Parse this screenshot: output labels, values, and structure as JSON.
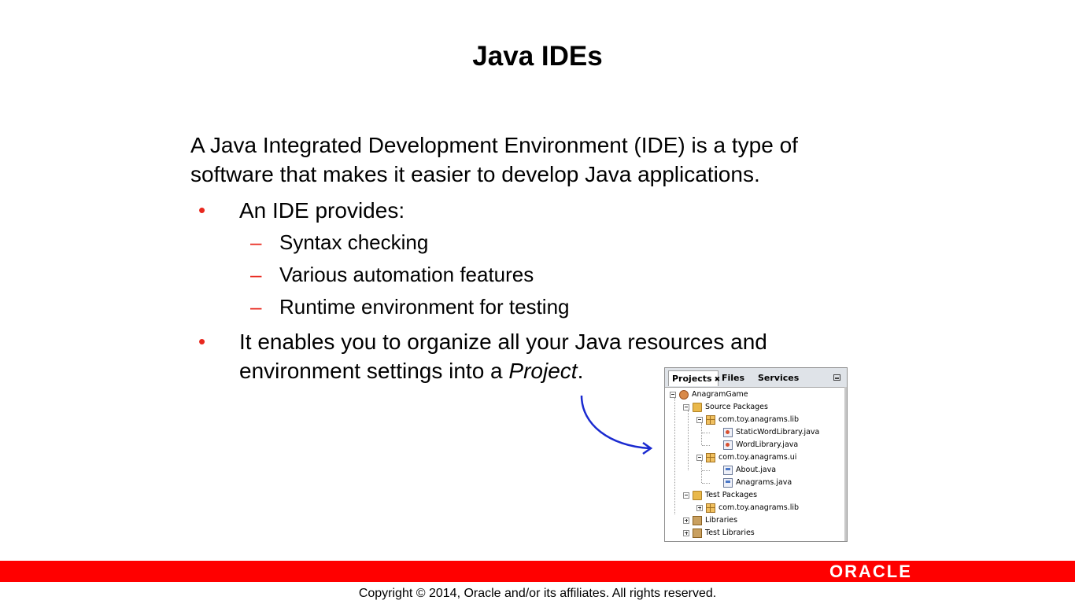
{
  "slide": {
    "title": "Java IDEs",
    "intro_line1": "A Java Integrated Development Environment (IDE) is a type of",
    "intro_line2": "software that makes it easier to develop Java applications.",
    "bullets": [
      {
        "text": "An IDE provides:",
        "subitems": [
          "Syntax checking",
          "Various automation features",
          "Runtime environment for testing"
        ]
      },
      {
        "line1": "It enables you to organize all your Java resources and",
        "line2_prefix": "environment settings into a ",
        "line2_italic": "Project",
        "line2_suffix": "."
      }
    ],
    "bullet_symbol": "•",
    "dash_symbol": "–"
  },
  "projects_panel": {
    "tabs": [
      {
        "label": "Projects",
        "active": true,
        "close": "✖"
      },
      {
        "label": "Files",
        "active": false
      },
      {
        "label": "Services",
        "active": false
      }
    ],
    "tree": [
      {
        "label": "AnagramGame",
        "icon": "project-icon"
      },
      {
        "label": "Source Packages",
        "icon": "folder-icon"
      },
      {
        "label": "com.toy.anagrams.lib",
        "icon": "package-icon"
      },
      {
        "label": "StaticWordLibrary.java",
        "icon": "java-icon"
      },
      {
        "label": "WordLibrary.java",
        "icon": "java-icon"
      },
      {
        "label": "com.toy.anagrams.ui",
        "icon": "package-icon"
      },
      {
        "label": "About.java",
        "icon": "form-icon"
      },
      {
        "label": "Anagrams.java",
        "icon": "form-icon"
      },
      {
        "label": "Test Packages",
        "icon": "folder-icon"
      },
      {
        "label": "com.toy.anagrams.lib",
        "icon": "package-icon"
      },
      {
        "label": "Libraries",
        "icon": "library-icon"
      },
      {
        "label": "Test Libraries",
        "icon": "library-icon"
      }
    ]
  },
  "footer": {
    "logo": "ORACLE",
    "copyright": "Copyright © 2014, Oracle and/or its affiliates. All rights reserved."
  },
  "colors": {
    "accent_red": "#ff0000",
    "bullet_red": "#e8281e",
    "arrow_blue": "#1a2ad0"
  }
}
